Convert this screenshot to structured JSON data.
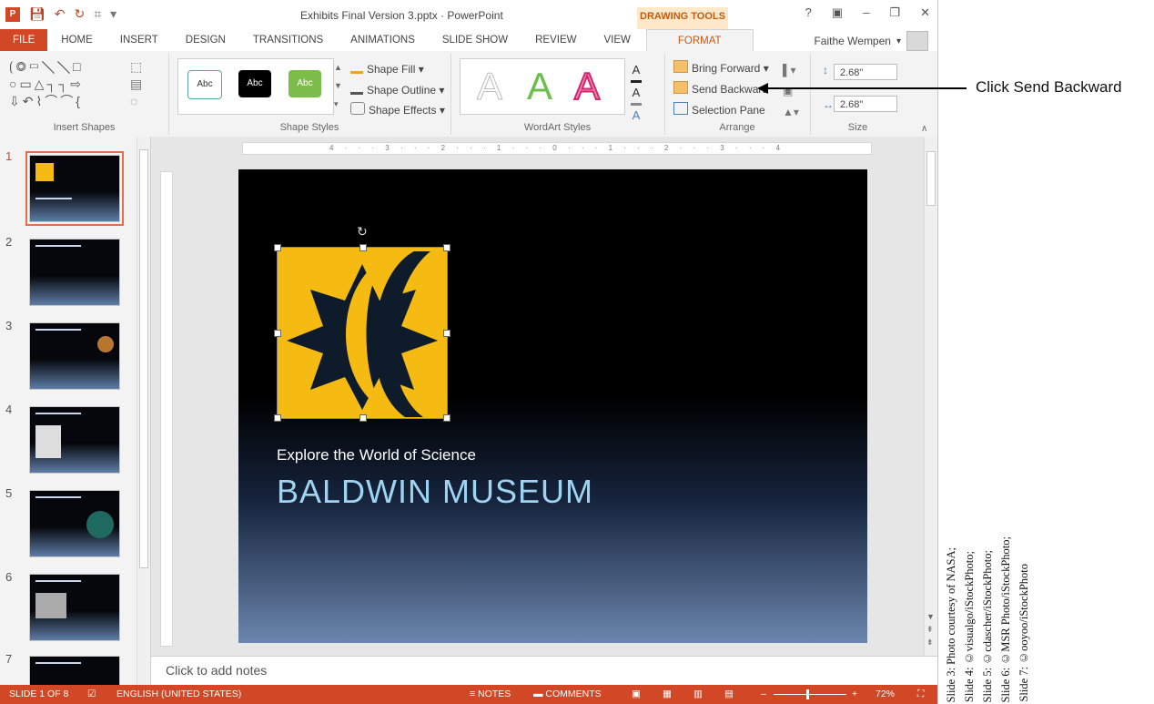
{
  "window": {
    "title": "Exhibits Final Version 3.pptx · PowerPoint",
    "contextual_tab": "DRAWING TOOLS",
    "help": "?",
    "controls": [
      "?",
      "▣",
      "–",
      "❐",
      "✕"
    ]
  },
  "tabs": [
    "FILE",
    "HOME",
    "INSERT",
    "DESIGN",
    "TRANSITIONS",
    "ANIMATIONS",
    "SLIDE SHOW",
    "REVIEW",
    "VIEW",
    "FORMAT"
  ],
  "user": {
    "name": "Faithe Wempen"
  },
  "ribbon": {
    "groups": {
      "insert_shapes": "Insert Shapes",
      "shape_styles": "Shape Styles",
      "wordart_styles": "WordArt Styles",
      "arrange": "Arrange",
      "size": "Size"
    },
    "shape_style_swatches": [
      "Abc",
      "Abc",
      "Abc"
    ],
    "shape_fill": "Shape Fill",
    "shape_outline": "Shape Outline",
    "shape_effects": "Shape Effects",
    "wordart": [
      "A",
      "A",
      "A"
    ],
    "bring_forward": "Bring Forward",
    "send_backward": "Send Backward",
    "selection_pane": "Selection Pane",
    "height": "2.68\"",
    "width": "2.68\""
  },
  "thumbnails": [
    {
      "num": "1",
      "selected": true
    },
    {
      "num": "2",
      "selected": false
    },
    {
      "num": "3",
      "selected": false
    },
    {
      "num": "4",
      "selected": false
    },
    {
      "num": "5",
      "selected": false
    },
    {
      "num": "6",
      "selected": false
    },
    {
      "num": "7",
      "selected": false
    }
  ],
  "slide": {
    "subtitle": "Explore the World of Science",
    "title": "BALDWIN MUSEUM"
  },
  "notes_placeholder": "Click to add notes",
  "status": {
    "slide_info": "SLIDE 1 OF 8",
    "language": "ENGLISH (UNITED STATES)",
    "notes": "NOTES",
    "comments": "COMMENTS",
    "zoom": "72%"
  },
  "callout": "Click Send Backward",
  "credits": [
    "Slide 3: Photo courtesy of NASA;",
    "Slide 4: ©visualgo/iStockPhoto;",
    "Slide 5: ©cdascher/iStockPhoto;",
    "Slide 6: ©MSR Photo/iStockPhoto;",
    "Slide 7: ©ooyoo/iStockPhoto"
  ],
  "colors": {
    "accent": "#d24726",
    "format_tab": "#c55a11",
    "logo_bg": "#f5bb13",
    "logo_fg": "#0d1b2a",
    "title": "#9fd3f2"
  }
}
